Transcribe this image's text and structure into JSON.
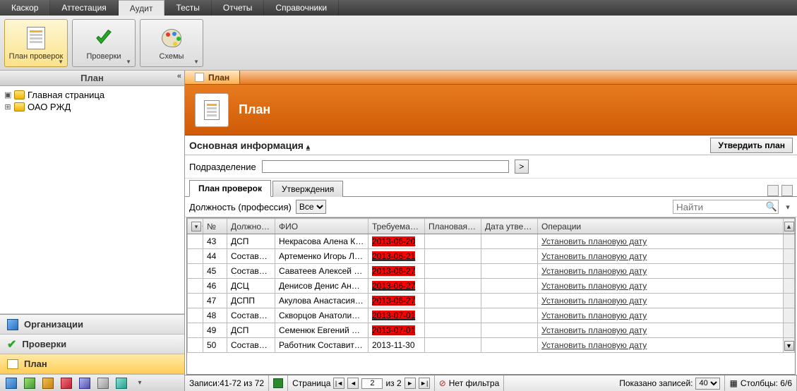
{
  "menu": [
    "Каскор",
    "Аттестация",
    "Аудит",
    "Тесты",
    "Отчеты",
    "Справочники"
  ],
  "menu_active": 2,
  "ribbon": [
    {
      "label": "План проверок",
      "icon": "doc",
      "sel": true
    },
    {
      "label": "Проверки",
      "icon": "check",
      "sel": false
    },
    {
      "label": "Схемы",
      "icon": "palette",
      "sel": false
    }
  ],
  "sidebar": {
    "title": "План",
    "tree": [
      {
        "label": "Главная страница",
        "expander": "▣",
        "indent": 0
      },
      {
        "label": "ОАО РЖД",
        "expander": "⊞",
        "indent": 0
      }
    ],
    "nav": [
      {
        "label": "Организации",
        "icon": "cube"
      },
      {
        "label": "Проверки",
        "icon": "check"
      },
      {
        "label": "План",
        "icon": "plan",
        "active": true
      }
    ]
  },
  "content": {
    "tab_label": "План",
    "banner_title": "План",
    "section_title": "Основная информация",
    "confirm_btn": "Утвердить план",
    "dept_label": "Подразделение",
    "inner_tabs": [
      "План проверок",
      "Утверждения"
    ],
    "job_filter_label": "Должность (профессия)",
    "job_filter_value": "Все",
    "search_placeholder": "Найти",
    "columns": [
      "№",
      "Должность",
      "ФИО",
      "Требуемая дата",
      "Плановая дата",
      "Дата утверждения",
      "Операции"
    ],
    "op_label": "Установить плановую дату",
    "rows": [
      {
        "n": "43",
        "pos": "ДСП",
        "fio": "Некрасова Алена Конс",
        "req": "2013-06-20",
        "red": true
      },
      {
        "n": "44",
        "pos": "Составите",
        "fio": "Артеменко Игорь Леон",
        "req": "2013-06-21",
        "red": true
      },
      {
        "n": "45",
        "pos": "Составите",
        "fio": "Саватеев Алексей Але",
        "req": "2013-06-27",
        "red": true
      },
      {
        "n": "46",
        "pos": "ДСЦ",
        "fio": "Денисов Денис Андрее",
        "req": "2013-06-27",
        "red": true
      },
      {
        "n": "47",
        "pos": "ДСПП",
        "fio": "Акулова Анастасия Ни",
        "req": "2013-06-27",
        "red": true
      },
      {
        "n": "48",
        "pos": "Составите",
        "fio": "Скворцов Анатолий Ва",
        "req": "2013-07-01",
        "red": true
      },
      {
        "n": "49",
        "pos": "ДСП",
        "fio": "Семенюк Евгений Мих",
        "req": "2013-07-01",
        "red": true
      },
      {
        "n": "50",
        "pos": "Составите",
        "fio": "Работник Составитель",
        "req": "2013-11-30",
        "red": false
      }
    ],
    "footer": {
      "records": "Записи:41-72 из 72",
      "page_label": "Страница",
      "page_value": "2",
      "page_total": "из 2",
      "filter": "Нет фильтра",
      "shown_label": "Показано записей:",
      "shown_value": "40",
      "cols": "Столбцы: 6/6"
    }
  }
}
